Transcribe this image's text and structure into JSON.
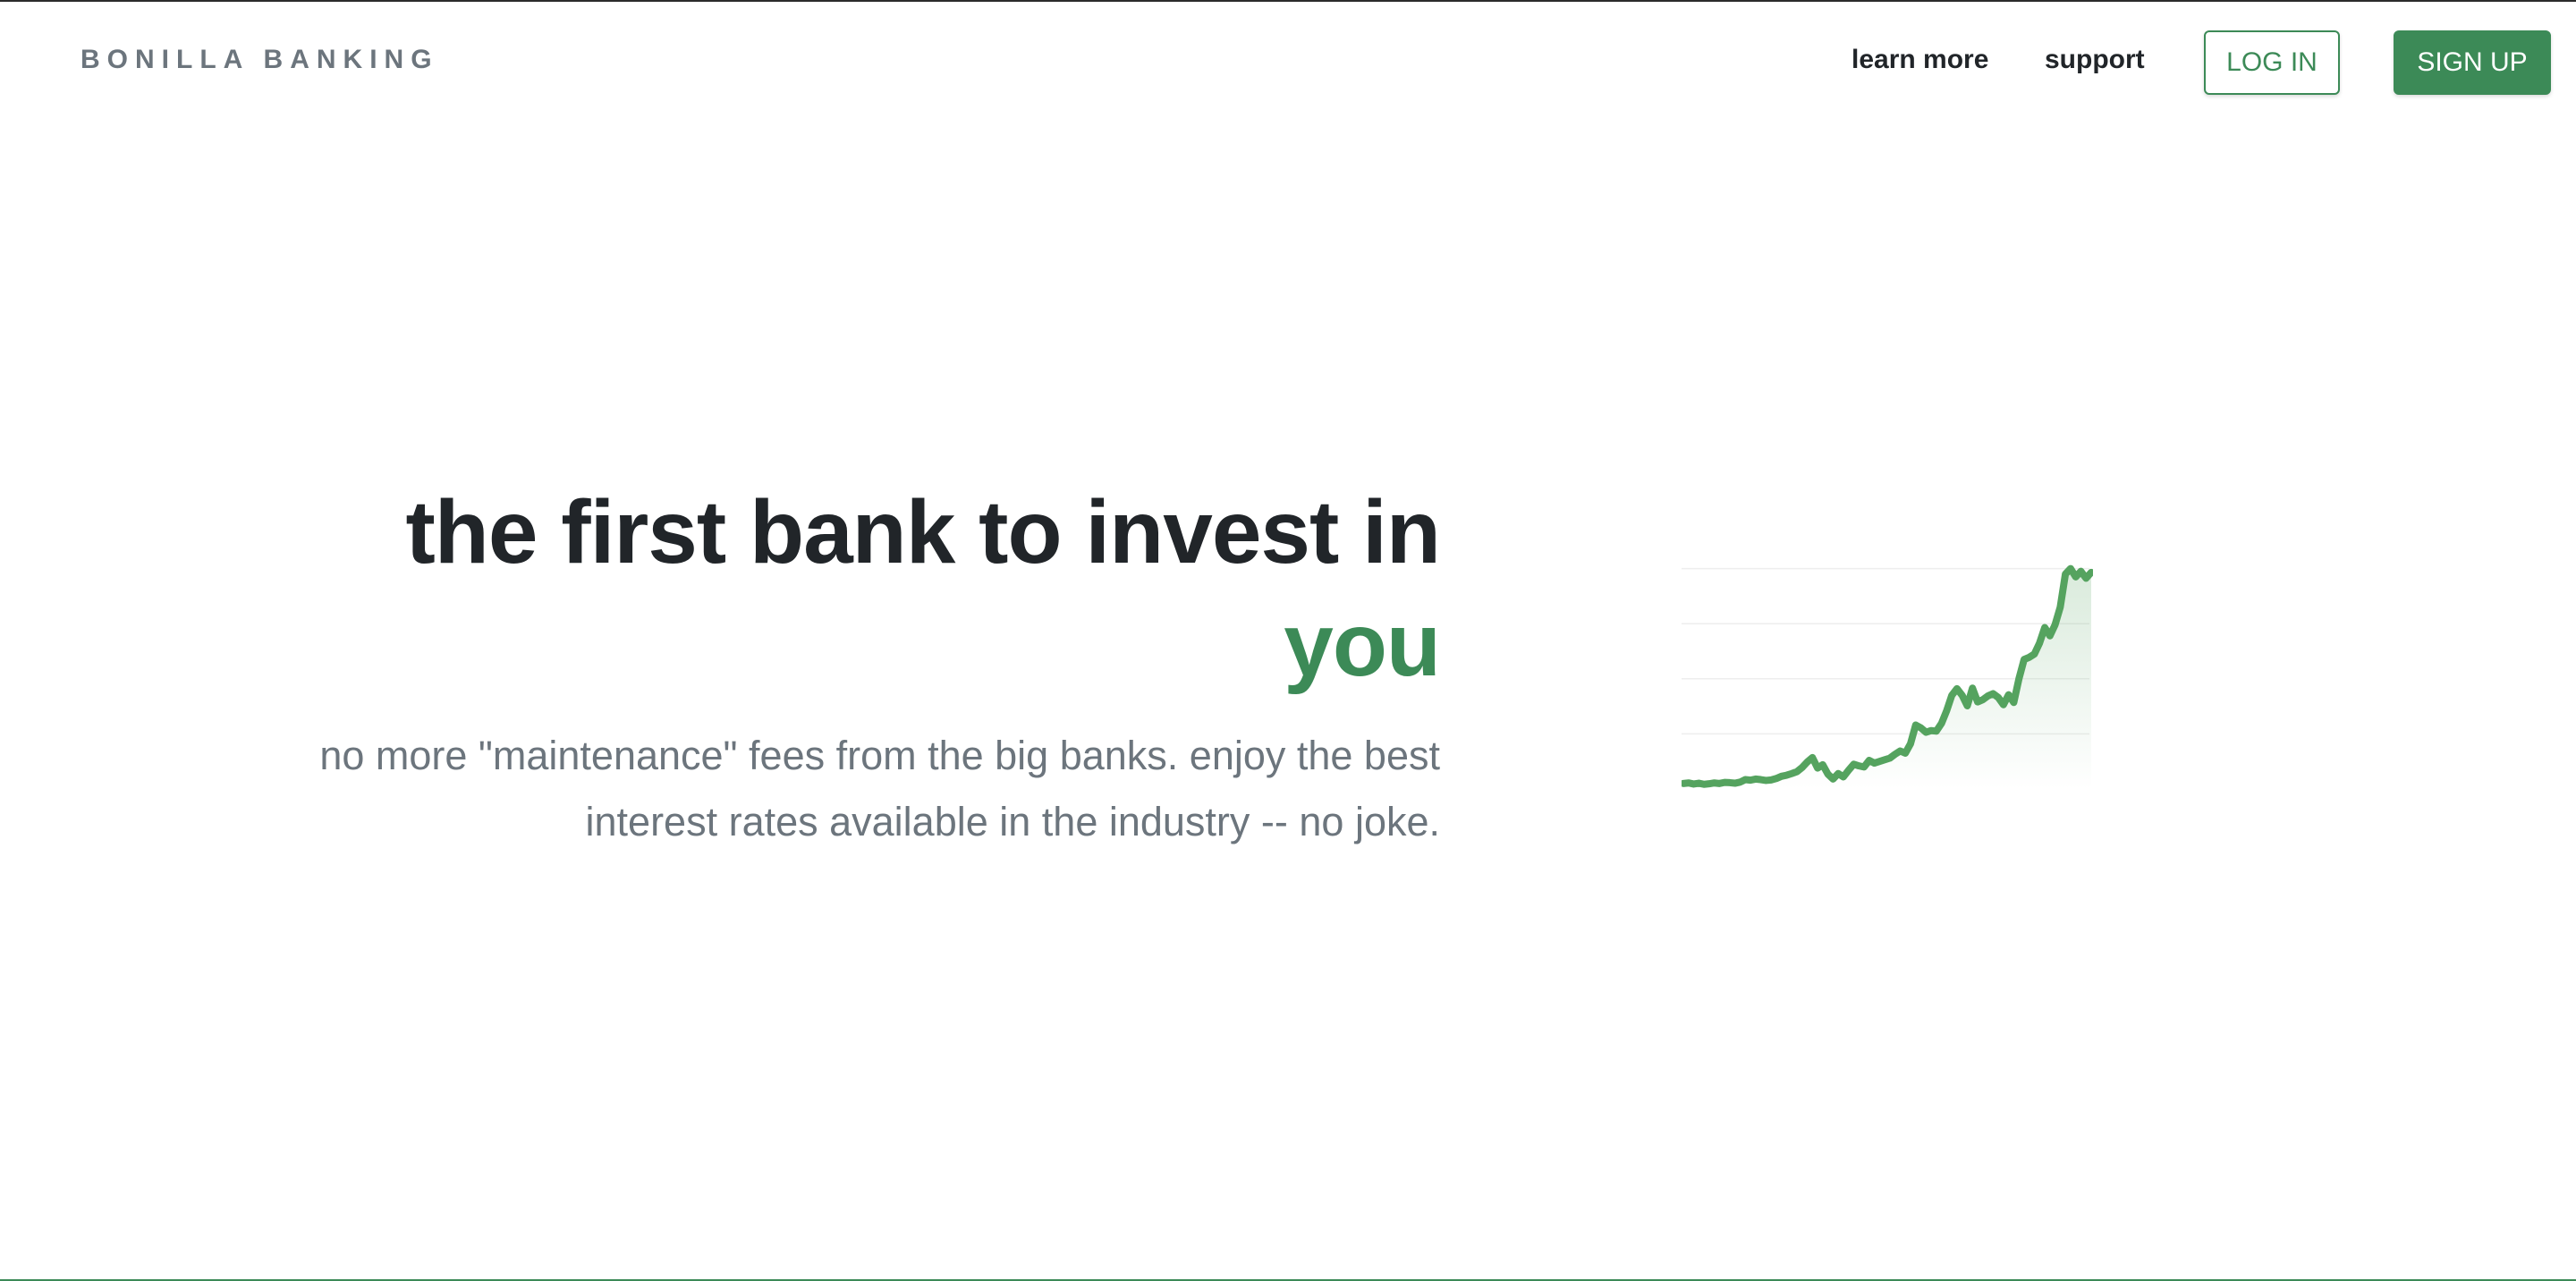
{
  "navbar": {
    "brand": "BONILLA BANKING",
    "links": [
      {
        "label": "learn more"
      },
      {
        "label": "support"
      }
    ],
    "login_label": "LOG IN",
    "signup_label": "SIGN UP"
  },
  "hero": {
    "headline": "the first bank to invest in",
    "headline_accent": "you",
    "subtext": "no more \"maintenance\" fees from the big banks. enjoy the best interest rates available in the industry -- no joke."
  },
  "colors": {
    "brand_green": "#3c8a57",
    "line_green": "#55a35f",
    "muted_text": "#6c757d",
    "dark_text": "#212529"
  },
  "chart_data": {
    "type": "area",
    "title": "",
    "xlabel": "",
    "ylabel": "",
    "grid": true,
    "legend": "none",
    "ylim": [
      0,
      100
    ],
    "x": [
      0,
      1,
      2,
      3,
      4,
      5,
      6,
      7,
      8,
      9,
      10,
      11,
      12,
      13,
      14,
      15,
      16,
      17,
      18,
      19,
      20,
      21,
      22,
      23,
      24,
      25,
      26,
      27,
      28,
      29,
      30,
      31,
      32,
      33,
      34,
      35,
      36,
      37,
      38,
      39,
      40,
      41,
      42,
      43,
      44,
      45,
      46,
      47,
      48,
      49,
      50,
      51,
      52,
      53,
      54,
      55,
      56,
      57,
      58,
      59,
      60,
      61,
      62,
      63,
      64,
      65,
      66,
      67,
      68,
      69,
      70,
      71,
      72,
      73,
      74,
      75,
      76,
      77,
      78,
      79,
      80,
      81,
      82,
      83,
      84,
      85,
      86,
      87,
      88,
      89,
      90,
      91,
      92,
      93,
      94,
      95,
      96,
      97,
      98,
      99
    ],
    "series": [
      {
        "values": [
          2,
          2.2,
          1.8,
          2.1,
          1.7,
          1.9,
          2.2,
          2,
          2.4,
          2.3,
          2.1,
          2.5,
          3.4,
          3.2,
          3.6,
          3.4,
          3.1,
          3.3,
          3.8,
          4.6,
          5,
          5.6,
          6.3,
          7.8,
          9.8,
          11.4,
          7.6,
          8.8,
          5.4,
          3.6,
          5.6,
          4.4,
          6.8,
          9,
          8.4,
          8,
          10.4,
          9.4,
          10,
          10.6,
          11.2,
          12.6,
          13.8,
          13,
          16.4,
          23.2,
          22.2,
          20.6,
          21.2,
          21,
          23.8,
          28.4,
          34,
          36.4,
          34,
          30.2,
          36.6,
          31.6,
          32.4,
          33.8,
          34.6,
          33.2,
          30.6,
          34.2,
          31.4,
          40,
          47,
          47.8,
          49,
          53,
          58.6,
          55.6,
          59.6,
          66,
          78,
          80,
          77,
          79,
          76.5,
          78.6
        ]
      }
    ]
  }
}
